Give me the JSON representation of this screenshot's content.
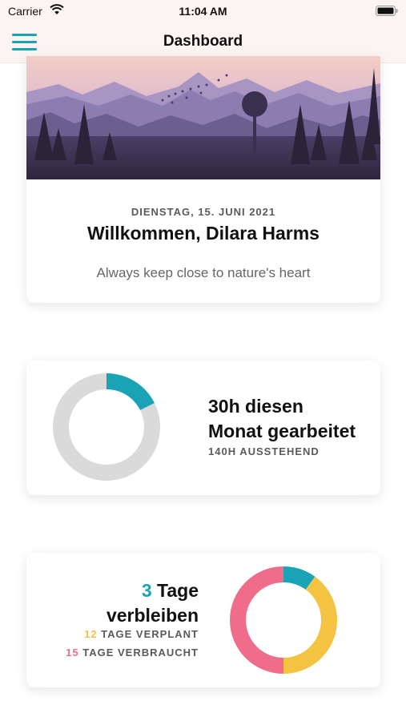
{
  "status_bar": {
    "carrier": "Carrier",
    "time": "11:04 AM"
  },
  "nav": {
    "title": "Dashboard",
    "menu_icon": "hamburger-icon"
  },
  "hero": {
    "date": "DIENSTAG, 15. JUNI 2021",
    "welcome": "Willkommen, Dilara Harms",
    "quote": "Always keep close to nature's heart"
  },
  "work": {
    "title_line1": "30h diesen",
    "title_line2": "Monat gearbeitet",
    "pending": "140H AUSSTEHEND",
    "chart_data": {
      "type": "pie",
      "donut": true,
      "slices": [
        {
          "label": "gearbeitet",
          "value": 30,
          "color": "#1aa3b5"
        },
        {
          "label": "ausstehend",
          "value": 140,
          "color": "#dadada"
        }
      ]
    }
  },
  "days": {
    "remaining_number": "3",
    "remaining_word": "Tage",
    "remaining_line2": "verbleiben",
    "planned_number": "12",
    "planned_label": "TAGE VERPLANT",
    "used_number": "15",
    "used_label": "TAGE VERBRAUCHT",
    "chart_data": {
      "type": "pie",
      "donut": true,
      "slices": [
        {
          "label": "verbleiben",
          "value": 3,
          "color": "#1aa3b5"
        },
        {
          "label": "verplant",
          "value": 12,
          "color": "#f5c342"
        },
        {
          "label": "verbraucht",
          "value": 15,
          "color": "#ef6d8a"
        }
      ]
    }
  },
  "colors": {
    "accent": "#1aa3b5",
    "planned": "#f5c342",
    "used": "#ef6d8a",
    "track": "#dadada"
  }
}
